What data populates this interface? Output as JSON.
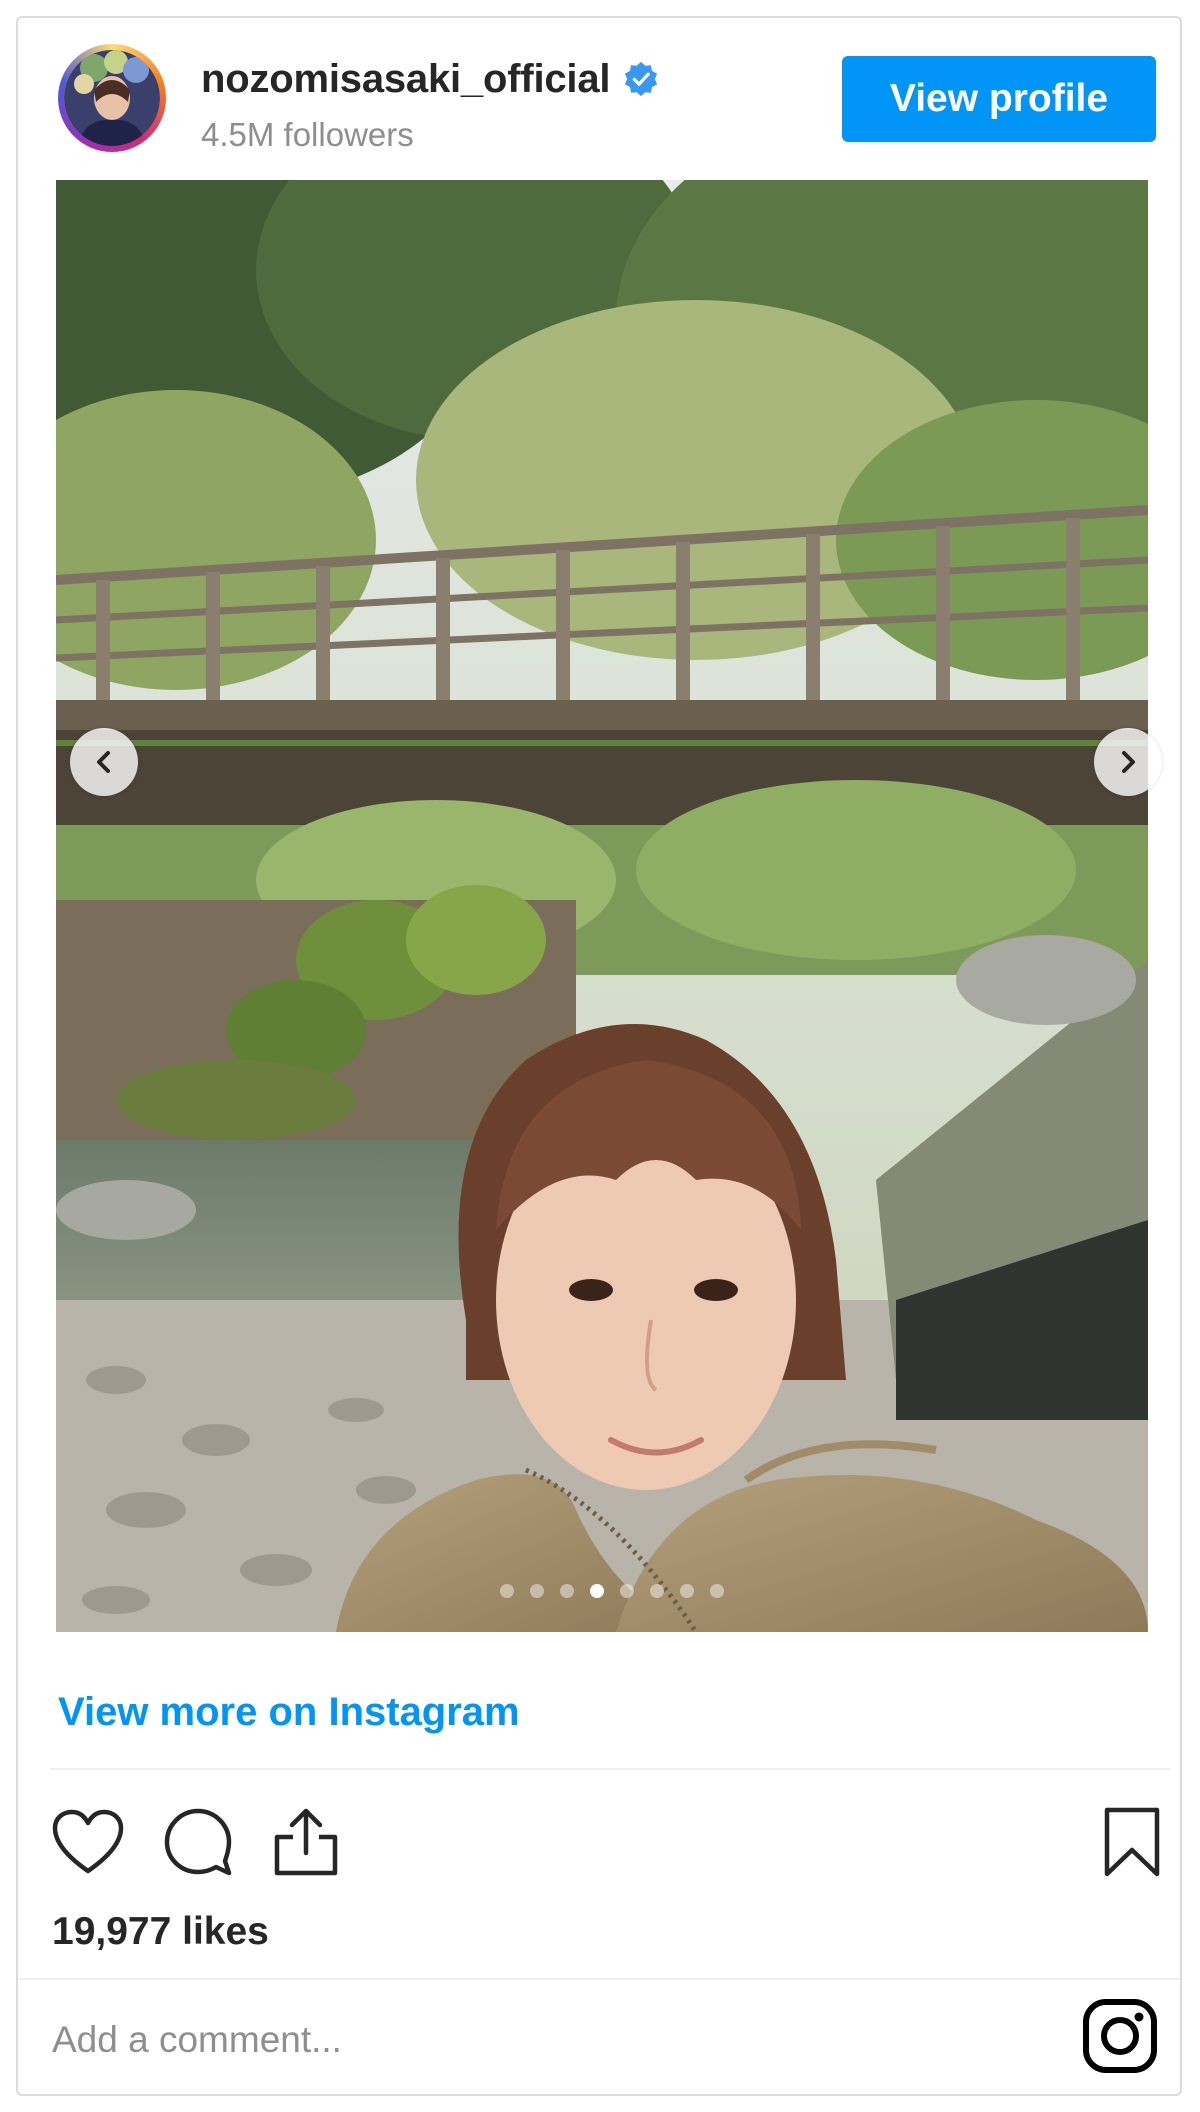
{
  "post": {
    "username": "nozomisasaki_official",
    "followers": "4.5M followers",
    "view_profile_label": "View profile",
    "view_more_label": "View more on Instagram",
    "likes": "19,977 likes",
    "comment_placeholder": "Add a comment...",
    "carousel": {
      "total_slides": 8,
      "active_slide": 4
    }
  },
  "icons": {
    "verified": "verified-badge-icon",
    "like": "heart-icon",
    "comment": "comment-icon",
    "share": "share-icon",
    "save": "bookmark-icon",
    "brand": "instagram-icon",
    "prev": "chevron-left-icon",
    "next": "chevron-right-icon"
  },
  "colors": {
    "accent": "#0095f6",
    "text": "#262626",
    "muted": "#8e8e8e",
    "border": "#dbdbdb"
  }
}
